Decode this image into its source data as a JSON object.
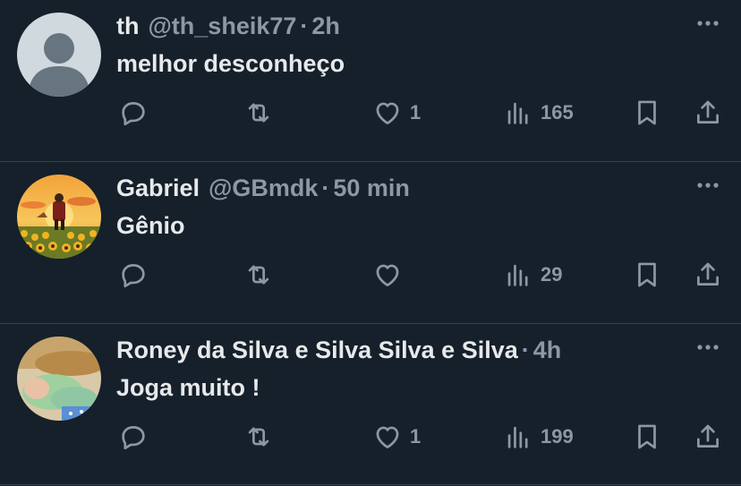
{
  "tweets": [
    {
      "name": "th",
      "handle": "@th_sheik77",
      "separator": "·",
      "time": "2h",
      "text": "melhor desconheço",
      "likes": "1",
      "views": "165",
      "avatar": "default-avatar"
    },
    {
      "name": "Gabriel",
      "handle": "@GBmdk",
      "separator": "·",
      "time": "50 min",
      "text": "Gênio",
      "likes": "",
      "views": "29",
      "avatar": "sunflower-field-avatar"
    },
    {
      "name": "Roney da Silva e Silva Silva e Silva",
      "handle": "",
      "separator": "·",
      "time": "4h",
      "text": "Joga muito !",
      "likes": "1",
      "views": "199",
      "avatar": "baby-photo-avatar"
    }
  ],
  "colors": {
    "background": "#15202b",
    "text": "#e7e9ea",
    "muted": "#8b98a5",
    "divider": "#38444d"
  }
}
